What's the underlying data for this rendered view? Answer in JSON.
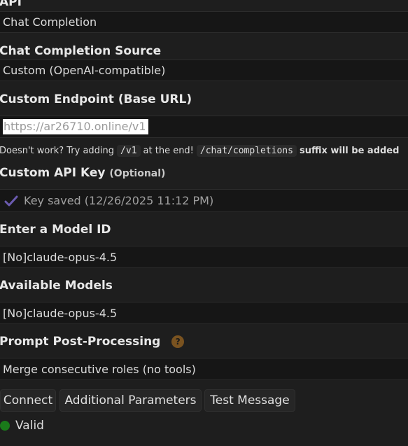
{
  "api": {
    "label": "API",
    "value": "Chat Completion"
  },
  "source": {
    "label": "Chat Completion Source",
    "value": "Custom (OpenAI-compatible)"
  },
  "endpoint": {
    "label": "Custom Endpoint (Base URL)",
    "value": "https://ar26710.online/v1"
  },
  "hint": {
    "prefix": "Doesn't work? Try adding",
    "code1": "/v1",
    "middle": "at the end!",
    "code2": "/chat/completions",
    "suffix": "suffix will be added"
  },
  "api_key": {
    "label": "Custom API Key",
    "optional": "(Optional)",
    "status": "Key saved (12/26/2025 11:12 PM)",
    "icon": "checkmark-icon",
    "icon_color": "#6b5bb0"
  },
  "model_id": {
    "label": "Enter a Model ID",
    "value": "[No]claude-opus-4.5"
  },
  "available_models": {
    "label": "Available Models",
    "value": "[No]claude-opus-4.5"
  },
  "post_processing": {
    "label": "Prompt Post-Processing",
    "help": "?",
    "value": "Merge consecutive roles (no tools)"
  },
  "buttons": {
    "connect": "Connect",
    "additional": "Additional Parameters",
    "test": "Test Message"
  },
  "status": {
    "text": "Valid",
    "color": "#1a7a1a"
  }
}
